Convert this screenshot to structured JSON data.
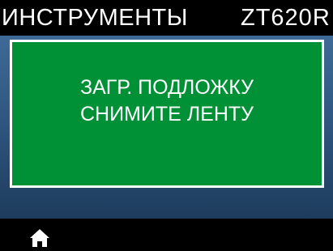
{
  "header": {
    "title": "ИНСТРУМЕНТЫ",
    "model": "ZT620R"
  },
  "message": {
    "line1": "ЗАГР. ПОДЛОЖКУ",
    "line2": "СНИМИТЕ ЛЕНТУ"
  },
  "footer": {
    "home_icon": "home-icon"
  },
  "colors": {
    "message_background": "#009035",
    "message_border": "#ffffff",
    "panel_background": "#2f5780",
    "bar_background": "#000000"
  }
}
